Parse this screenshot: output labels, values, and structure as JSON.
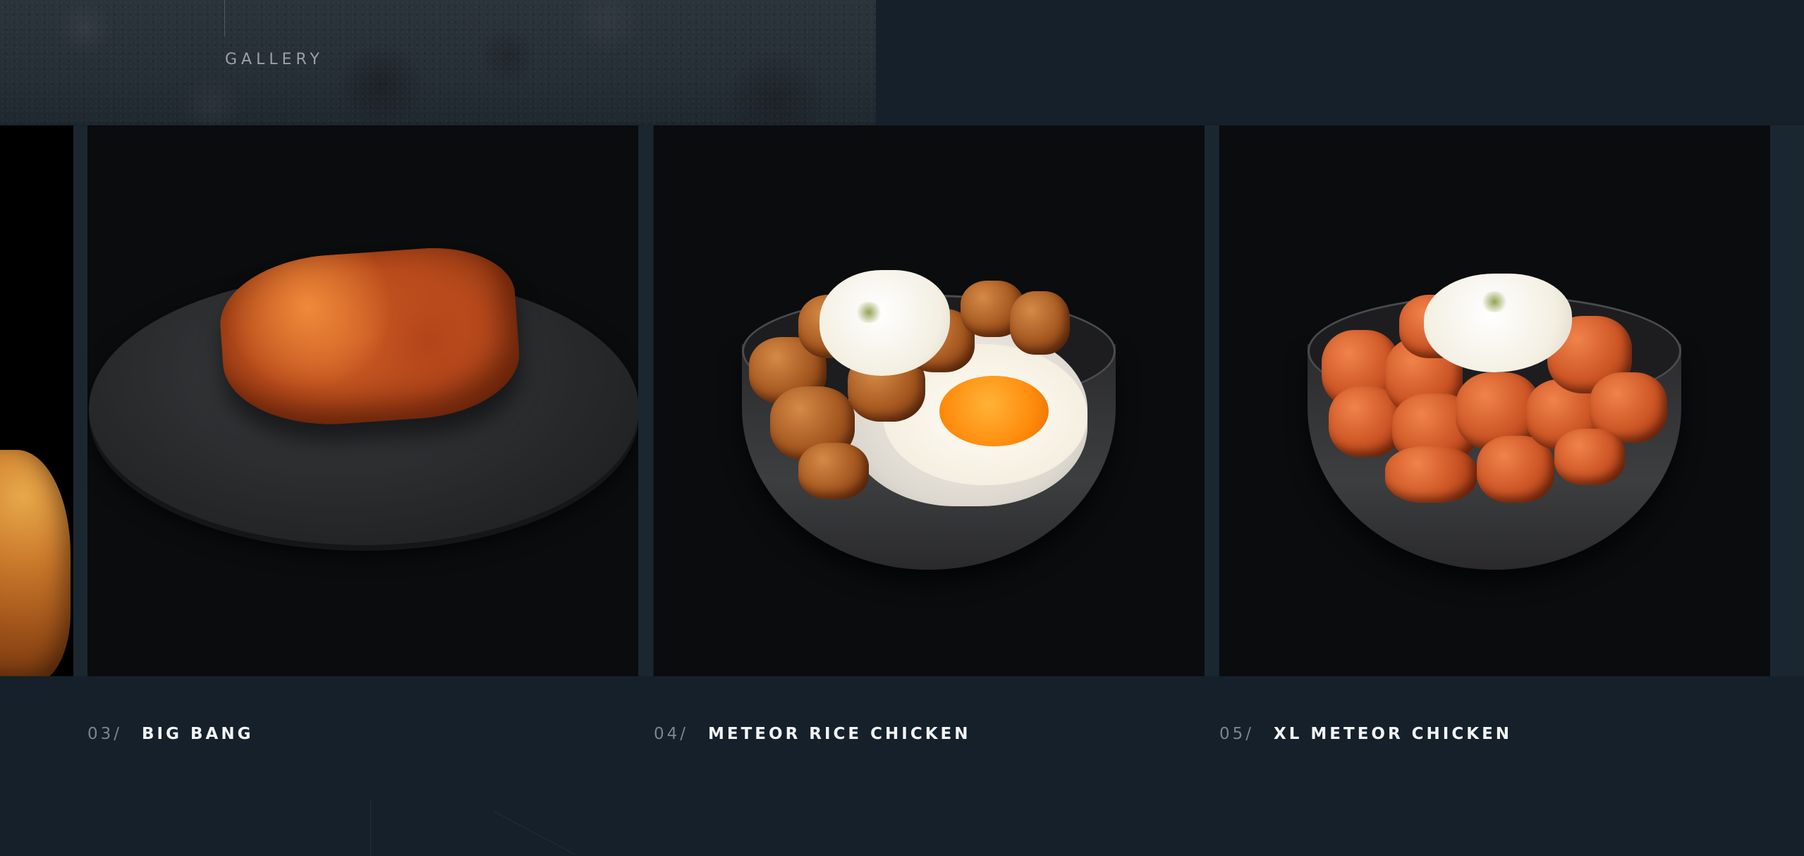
{
  "gallery": {
    "section_label": "GALLERY",
    "items": [
      {
        "number": "03/",
        "title": "BIG BANG"
      },
      {
        "number": "04/",
        "title": "METEOR RICE CHICKEN"
      },
      {
        "number": "05/",
        "title": "XL METEOR CHICKEN"
      }
    ]
  },
  "colors": {
    "background": "#15202a",
    "card_background": "#0a0c0e",
    "caption_title": "#f2f4f5",
    "caption_number": "#7c858d"
  }
}
